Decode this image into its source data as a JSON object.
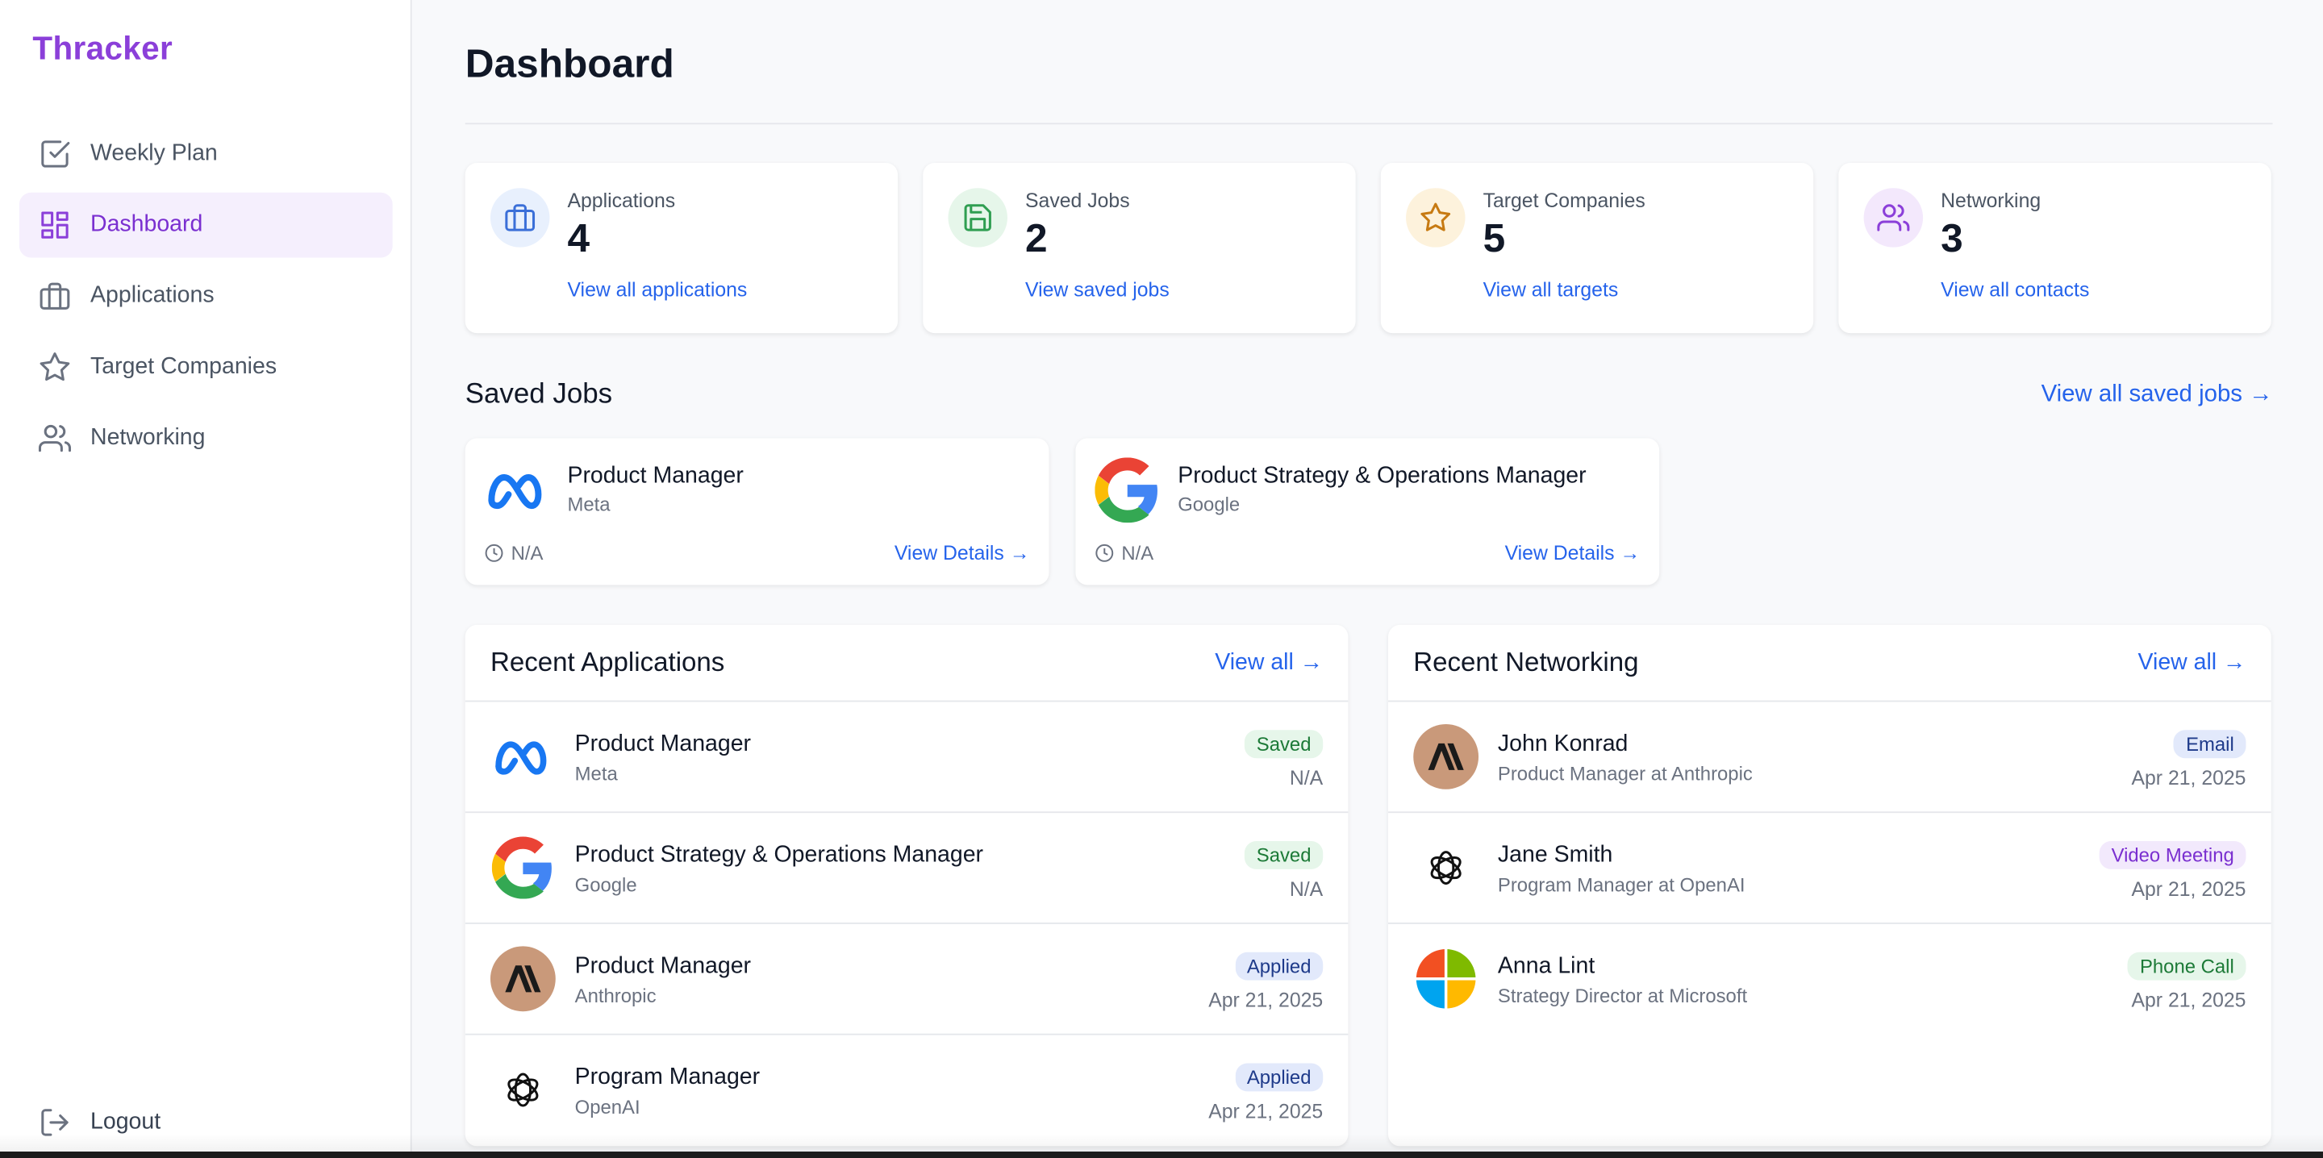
{
  "brand": "Thracker",
  "sidebar": {
    "items": [
      {
        "label": "Weekly Plan",
        "icon": "checkbox-icon",
        "active": false
      },
      {
        "label": "Dashboard",
        "icon": "grid-icon",
        "active": true
      },
      {
        "label": "Applications",
        "icon": "briefcase-icon",
        "active": false
      },
      {
        "label": "Target Companies",
        "icon": "star-icon",
        "active": false
      },
      {
        "label": "Networking",
        "icon": "users-icon",
        "active": false
      }
    ],
    "logout_label": "Logout"
  },
  "page_title": "Dashboard",
  "stats": [
    {
      "label": "Applications",
      "value": "4",
      "link": "View all applications",
      "icon": "briefcase-icon",
      "color": "#3b6fd8",
      "bg": "#e8f0fd"
    },
    {
      "label": "Saved Jobs",
      "value": "2",
      "link": "View saved jobs",
      "icon": "save-icon",
      "color": "#2f9e51",
      "bg": "#e6f6ea"
    },
    {
      "label": "Target Companies",
      "value": "5",
      "link": "View all targets",
      "icon": "star-icon",
      "color": "#c77a12",
      "bg": "#fdf2dc"
    },
    {
      "label": "Networking",
      "value": "3",
      "link": "View all contacts",
      "icon": "users-icon",
      "color": "#8b3fd9",
      "bg": "#f3e8fc"
    }
  ],
  "saved_jobs": {
    "title": "Saved Jobs",
    "view_all": "View all saved jobs →",
    "items": [
      {
        "title": "Product Manager",
        "company": "Meta",
        "meta": "N/A",
        "link": "View Details →",
        "logo": "meta-logo-icon"
      },
      {
        "title": "Product Strategy & Operations Manager",
        "company": "Google",
        "meta": "N/A",
        "link": "View Details →",
        "logo": "google-logo-icon"
      }
    ]
  },
  "recent_applications": {
    "title": "Recent Applications",
    "view_all": "View all →",
    "rows": [
      {
        "title": "Product Manager",
        "company": "Meta",
        "status": "Saved",
        "date": "N/A",
        "logo": "meta-logo-icon",
        "badge_color": "green"
      },
      {
        "title": "Product Strategy & Operations Manager",
        "company": "Google",
        "status": "Saved",
        "date": "N/A",
        "logo": "google-logo-icon",
        "badge_color": "green"
      },
      {
        "title": "Product Manager",
        "company": "Anthropic",
        "status": "Applied",
        "date": "Apr 21, 2025",
        "logo": "anthropic-logo-icon",
        "badge_color": "blue"
      },
      {
        "title": "Program Manager",
        "company": "OpenAI",
        "status": "Applied",
        "date": "Apr 21, 2025",
        "logo": "openai-logo-icon",
        "badge_color": "blue"
      }
    ]
  },
  "recent_networking": {
    "title": "Recent Networking",
    "view_all": "View all →",
    "rows": [
      {
        "name": "John Konrad",
        "role": "Product Manager at Anthropic",
        "type": "Email",
        "date": "Apr 21, 2025",
        "logo": "anthropic-logo-icon",
        "badge_color": "blue"
      },
      {
        "name": "Jane Smith",
        "role": "Program Manager at OpenAI",
        "type": "Video Meeting",
        "date": "Apr 21, 2025",
        "logo": "openai-logo-icon",
        "badge_color": "purple"
      },
      {
        "name": "Anna Lint",
        "role": "Strategy Director at Microsoft",
        "type": "Phone Call",
        "date": "Apr 21, 2025",
        "logo": "microsoft-logo-icon",
        "badge_color": "green"
      }
    ]
  }
}
